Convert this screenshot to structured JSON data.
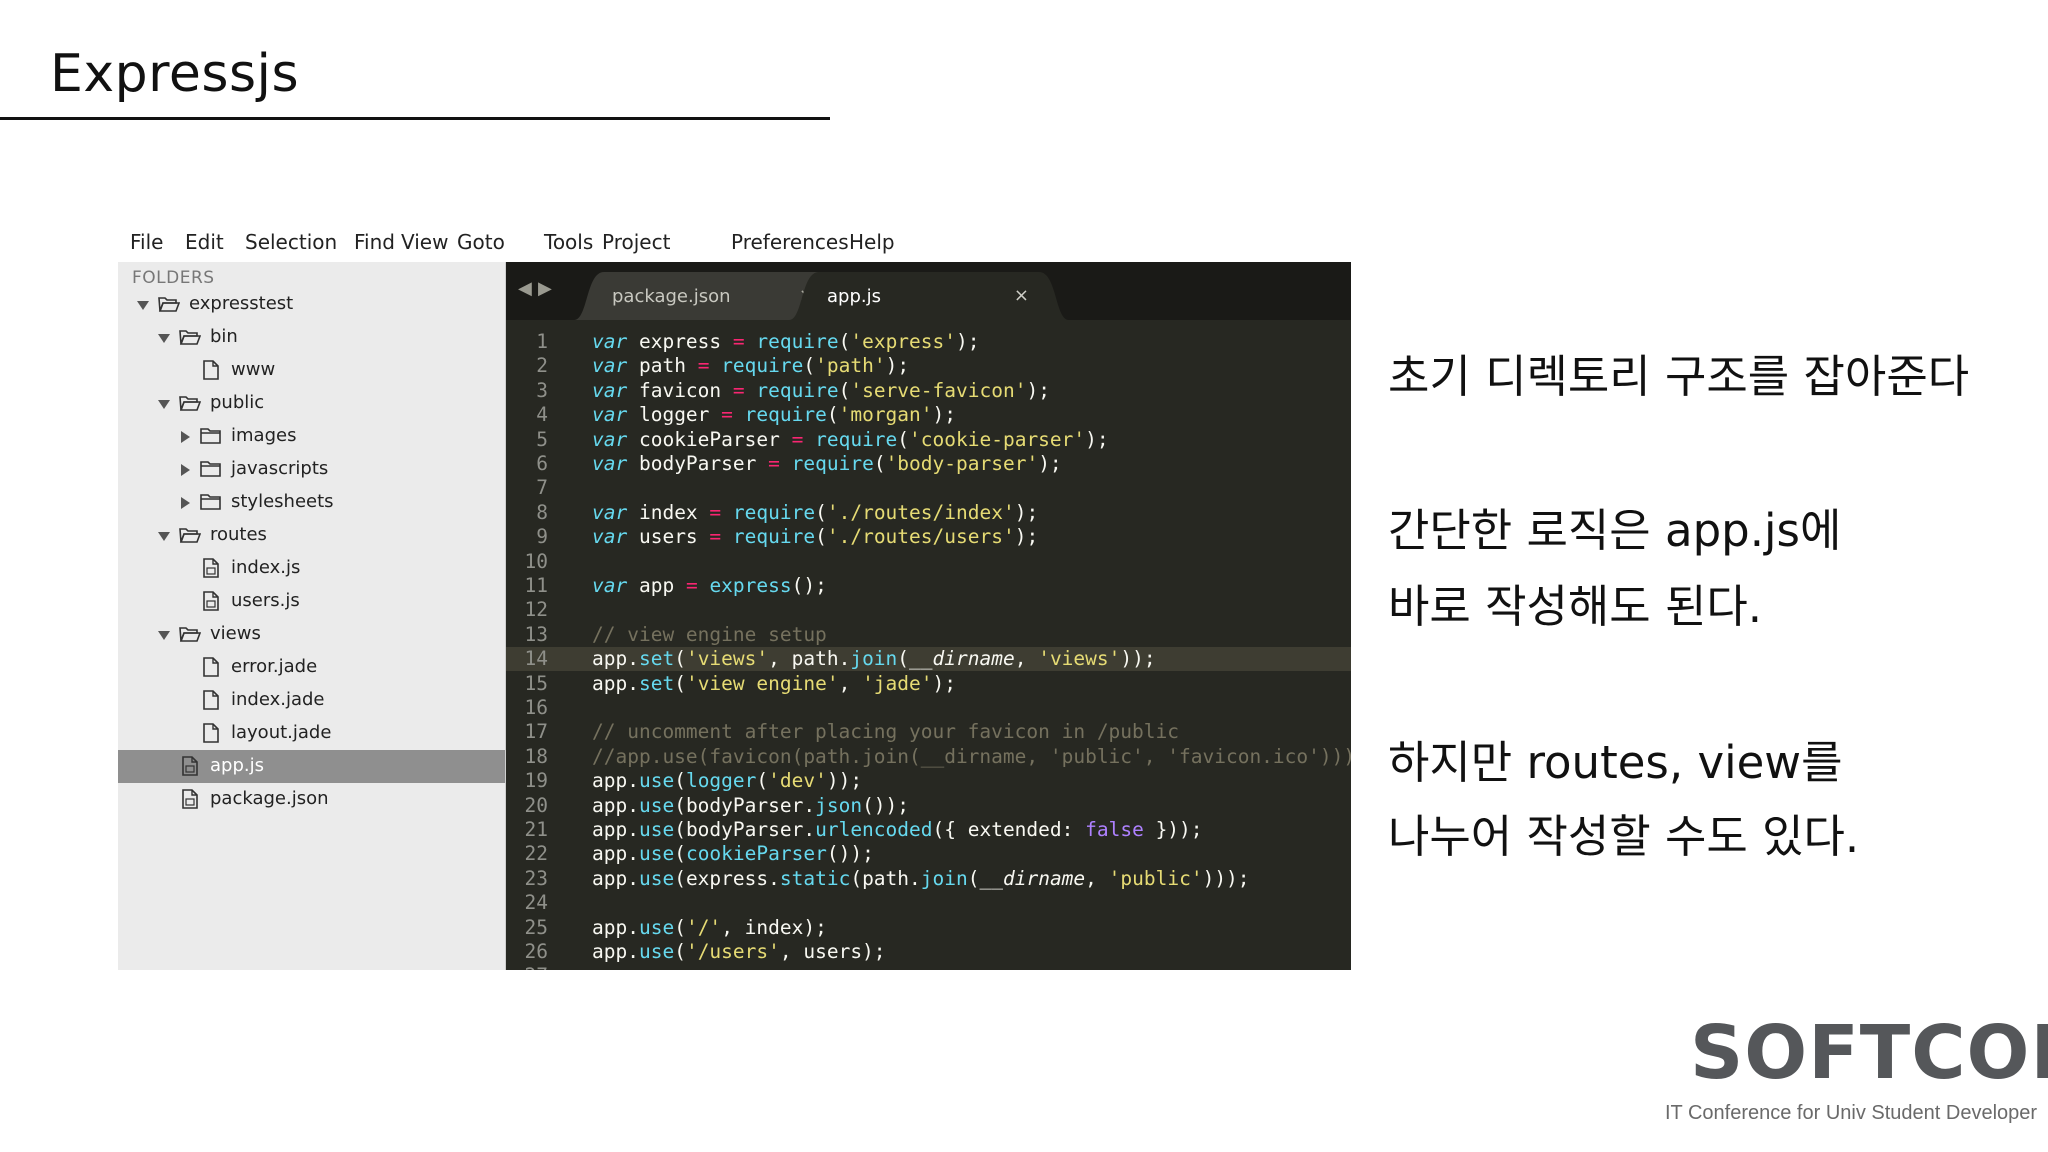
{
  "slide": {
    "title": "Expressjs"
  },
  "editor": {
    "menu": [
      "File",
      "Edit",
      "Selection",
      "Find",
      "View",
      "Goto",
      "Tools",
      "Project",
      "Preferences",
      "Help"
    ],
    "sidebar": {
      "header": "FOLDERS",
      "tree": [
        {
          "label": "expresstest",
          "type": "folder",
          "state": "open",
          "depth": 0
        },
        {
          "label": "bin",
          "type": "folder",
          "state": "open",
          "depth": 1
        },
        {
          "label": "www",
          "type": "file",
          "depth": 2
        },
        {
          "label": "public",
          "type": "folder",
          "state": "open",
          "depth": 1
        },
        {
          "label": "images",
          "type": "folder",
          "state": "closed",
          "depth": 2
        },
        {
          "label": "javascripts",
          "type": "folder",
          "state": "closed",
          "depth": 2
        },
        {
          "label": "stylesheets",
          "type": "folder",
          "state": "closed",
          "depth": 2
        },
        {
          "label": "routes",
          "type": "folder",
          "state": "open",
          "depth": 1
        },
        {
          "label": "index.js",
          "type": "jsfile",
          "depth": 2
        },
        {
          "label": "users.js",
          "type": "jsfile",
          "depth": 2
        },
        {
          "label": "views",
          "type": "folder",
          "state": "open",
          "depth": 1
        },
        {
          "label": "error.jade",
          "type": "file",
          "depth": 2
        },
        {
          "label": "index.jade",
          "type": "file",
          "depth": 2
        },
        {
          "label": "layout.jade",
          "type": "file",
          "depth": 2
        },
        {
          "label": "app.js",
          "type": "jsfile",
          "depth": 1,
          "selected": true
        },
        {
          "label": "package.json",
          "type": "jsfile",
          "depth": 1
        }
      ]
    },
    "tabs": [
      {
        "label": "package.json",
        "active": false,
        "close": "×"
      },
      {
        "label": "app.js",
        "active": true,
        "close": "×"
      }
    ],
    "current_line": 14,
    "code": [
      [
        [
          "kw",
          "var"
        ],
        [
          "t",
          " express "
        ],
        [
          "op",
          "="
        ],
        [
          "t",
          " "
        ],
        [
          "fn",
          "require"
        ],
        [
          "t",
          "("
        ],
        [
          "str",
          "'express'"
        ],
        [
          "t",
          ");"
        ]
      ],
      [
        [
          "kw",
          "var"
        ],
        [
          "t",
          " path "
        ],
        [
          "op",
          "="
        ],
        [
          "t",
          " "
        ],
        [
          "fn",
          "require"
        ],
        [
          "t",
          "("
        ],
        [
          "str",
          "'path'"
        ],
        [
          "t",
          ");"
        ]
      ],
      [
        [
          "kw",
          "var"
        ],
        [
          "t",
          " favicon "
        ],
        [
          "op",
          "="
        ],
        [
          "t",
          " "
        ],
        [
          "fn",
          "require"
        ],
        [
          "t",
          "("
        ],
        [
          "str",
          "'serve-favicon'"
        ],
        [
          "t",
          ");"
        ]
      ],
      [
        [
          "kw",
          "var"
        ],
        [
          "t",
          " logger "
        ],
        [
          "op",
          "="
        ],
        [
          "t",
          " "
        ],
        [
          "fn",
          "require"
        ],
        [
          "t",
          "("
        ],
        [
          "str",
          "'morgan'"
        ],
        [
          "t",
          ");"
        ]
      ],
      [
        [
          "kw",
          "var"
        ],
        [
          "t",
          " cookieParser "
        ],
        [
          "op",
          "="
        ],
        [
          "t",
          " "
        ],
        [
          "fn",
          "require"
        ],
        [
          "t",
          "("
        ],
        [
          "str",
          "'cookie-parser'"
        ],
        [
          "t",
          ");"
        ]
      ],
      [
        [
          "kw",
          "var"
        ],
        [
          "t",
          " bodyParser "
        ],
        [
          "op",
          "="
        ],
        [
          "t",
          " "
        ],
        [
          "fn",
          "require"
        ],
        [
          "t",
          "("
        ],
        [
          "str",
          "'body-parser'"
        ],
        [
          "t",
          ");"
        ]
      ],
      [],
      [
        [
          "kw",
          "var"
        ],
        [
          "t",
          " index "
        ],
        [
          "op",
          "="
        ],
        [
          "t",
          " "
        ],
        [
          "fn",
          "require"
        ],
        [
          "t",
          "("
        ],
        [
          "str",
          "'./routes/index'"
        ],
        [
          "t",
          ");"
        ]
      ],
      [
        [
          "kw",
          "var"
        ],
        [
          "t",
          " users "
        ],
        [
          "op",
          "="
        ],
        [
          "t",
          " "
        ],
        [
          "fn",
          "require"
        ],
        [
          "t",
          "("
        ],
        [
          "str",
          "'./routes/users'"
        ],
        [
          "t",
          ");"
        ]
      ],
      [],
      [
        [
          "kw",
          "var"
        ],
        [
          "t",
          " app "
        ],
        [
          "op",
          "="
        ],
        [
          "t",
          " "
        ],
        [
          "fn",
          "express"
        ],
        [
          "t",
          "();"
        ]
      ],
      [],
      [
        [
          "cm",
          "// view engine setup"
        ]
      ],
      [
        [
          "t",
          "app."
        ],
        [
          "fn",
          "set"
        ],
        [
          "t",
          "("
        ],
        [
          "str",
          "'views'"
        ],
        [
          "t",
          ", path."
        ],
        [
          "fn",
          "join"
        ],
        [
          "t",
          "("
        ],
        [
          "it",
          "__dirname"
        ],
        [
          "t",
          ", "
        ],
        [
          "str",
          "'views'"
        ],
        [
          "t",
          "));"
        ]
      ],
      [
        [
          "t",
          "app."
        ],
        [
          "fn",
          "set"
        ],
        [
          "t",
          "("
        ],
        [
          "str",
          "'view engine'"
        ],
        [
          "t",
          ", "
        ],
        [
          "str",
          "'jade'"
        ],
        [
          "t",
          ");"
        ]
      ],
      [],
      [
        [
          "cm",
          "// uncomment after placing your favicon in /public"
        ]
      ],
      [
        [
          "cm",
          "//app.use(favicon(path.join(__dirname, 'public', 'favicon.ico')));"
        ]
      ],
      [
        [
          "t",
          "app."
        ],
        [
          "fn",
          "use"
        ],
        [
          "t",
          "("
        ],
        [
          "fn",
          "logger"
        ],
        [
          "t",
          "("
        ],
        [
          "str",
          "'dev'"
        ],
        [
          "t",
          "));"
        ]
      ],
      [
        [
          "t",
          "app."
        ],
        [
          "fn",
          "use"
        ],
        [
          "t",
          "(bodyParser."
        ],
        [
          "fn",
          "json"
        ],
        [
          "t",
          "());"
        ]
      ],
      [
        [
          "t",
          "app."
        ],
        [
          "fn",
          "use"
        ],
        [
          "t",
          "(bodyParser."
        ],
        [
          "fn",
          "urlencoded"
        ],
        [
          "t",
          "({ extended: "
        ],
        [
          "bool",
          "false"
        ],
        [
          "t",
          " }));"
        ]
      ],
      [
        [
          "t",
          "app."
        ],
        [
          "fn",
          "use"
        ],
        [
          "t",
          "("
        ],
        [
          "fn",
          "cookieParser"
        ],
        [
          "t",
          "());"
        ]
      ],
      [
        [
          "t",
          "app."
        ],
        [
          "fn",
          "use"
        ],
        [
          "t",
          "(express."
        ],
        [
          "fn",
          "static"
        ],
        [
          "t",
          "(path."
        ],
        [
          "fn",
          "join"
        ],
        [
          "t",
          "("
        ],
        [
          "it",
          "__dirname"
        ],
        [
          "t",
          ", "
        ],
        [
          "str",
          "'public'"
        ],
        [
          "t",
          ")));"
        ]
      ],
      [],
      [
        [
          "t",
          "app."
        ],
        [
          "fn",
          "use"
        ],
        [
          "t",
          "("
        ],
        [
          "str",
          "'/'"
        ],
        [
          "t",
          ", index);"
        ]
      ],
      [
        [
          "t",
          "app."
        ],
        [
          "fn",
          "use"
        ],
        [
          "t",
          "("
        ],
        [
          "str",
          "'/users'"
        ],
        [
          "t",
          ", users);"
        ]
      ],
      []
    ]
  },
  "notes": {
    "line1": "초기 디렉토리 구조를 잡아준다",
    "line2": "간단한 로직은 app.js에",
    "line3": "바로 작성해도 된다.",
    "line4": "하지만 routes, view를",
    "line5": "나누어 작성할 수도 있다."
  },
  "footer": {
    "brand": "SOFTCON",
    "tagline": "IT Conference for Univ Student Developer"
  },
  "colors": {
    "editor_bg": "#272822",
    "keyword": "#66d9ef",
    "string": "#e6db74",
    "operator": "#f92672",
    "comment": "#75715e",
    "boolean": "#ae81ff",
    "sidebar_bg": "#ebebeb",
    "selected_row": "#8f8f8f",
    "brand_gray": "#55575a"
  }
}
